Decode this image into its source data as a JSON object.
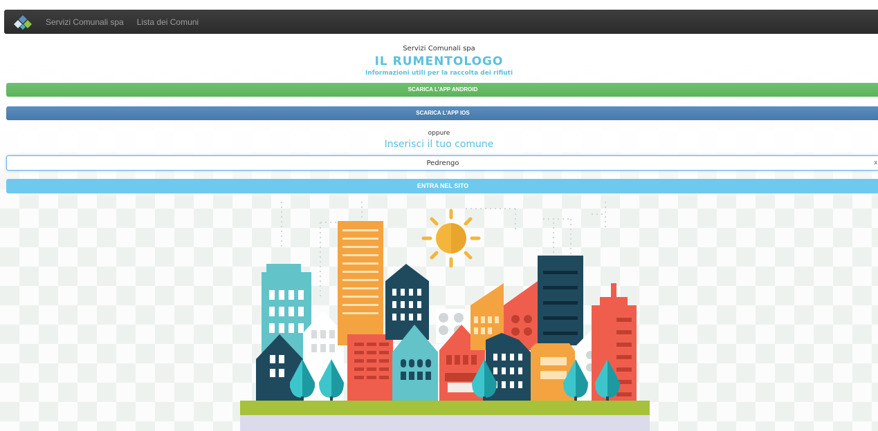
{
  "navbar": {
    "brand_icon": "diamond-logo-icon",
    "links": [
      "Servizi Comunali spa",
      "Lista dei Comuni"
    ]
  },
  "header": {
    "company": "Servizi Comunali spa",
    "title": "IL RUMENTOLOGO",
    "subtitle": "Informazioni utili per la raccolta dei rifiuti"
  },
  "buttons": {
    "android": "SCARICA L'APP ANDROID",
    "ios": "SCARICA L'APP IOS",
    "enter": "ENTRA NEL SITO"
  },
  "search": {
    "separator": "oppure",
    "prompt": "Inserisci il tuo comune",
    "value": "Pedrengo",
    "clear_label": "x"
  },
  "colors": {
    "accent": "#5bc0de",
    "android": "#5cb25c",
    "ios": "#4778a8",
    "enter": "#6ec9ee",
    "navbar": "#333333"
  },
  "illustration": "city-skyline-illustration"
}
